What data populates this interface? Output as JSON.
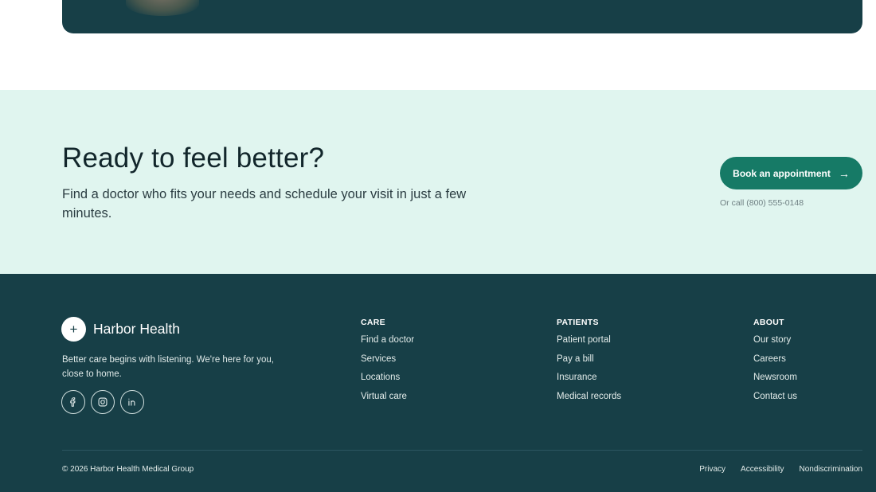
{
  "cta": {
    "title": "Ready to feel better?",
    "description": "Find a doctor who fits your needs and schedule your visit in just a few minutes.",
    "button_label": "Book an appointment",
    "button_arrow": "→",
    "call_note": "Or call (800) 555-0148"
  },
  "footer": {
    "brand": {
      "mark": "+",
      "name": "Harbor Health"
    },
    "tagline": "Better care begins with listening. We're here for you, close to home.",
    "socials": [
      {
        "icon": "facebook-icon"
      },
      {
        "icon": "instagram-icon"
      },
      {
        "icon": "linkedin-icon"
      }
    ],
    "columns": [
      {
        "heading": "CARE",
        "links": [
          "Find a doctor",
          "Services",
          "Locations",
          "Virtual care"
        ]
      },
      {
        "heading": "PATIENTS",
        "links": [
          "Patient portal",
          "Pay a bill",
          "Insurance",
          "Medical records"
        ]
      },
      {
        "heading": "ABOUT",
        "links": [
          "Our story",
          "Careers",
          "Newsroom",
          "Contact us"
        ]
      }
    ],
    "copyright": "© 2026 Harbor Health Medical Group",
    "legal_links": [
      "Privacy",
      "Accessibility",
      "Nondiscrimination"
    ]
  },
  "colors": {
    "dark_teal": "#173f47",
    "cta_background": "#e0f5ef",
    "accent_green": "#167a66"
  }
}
